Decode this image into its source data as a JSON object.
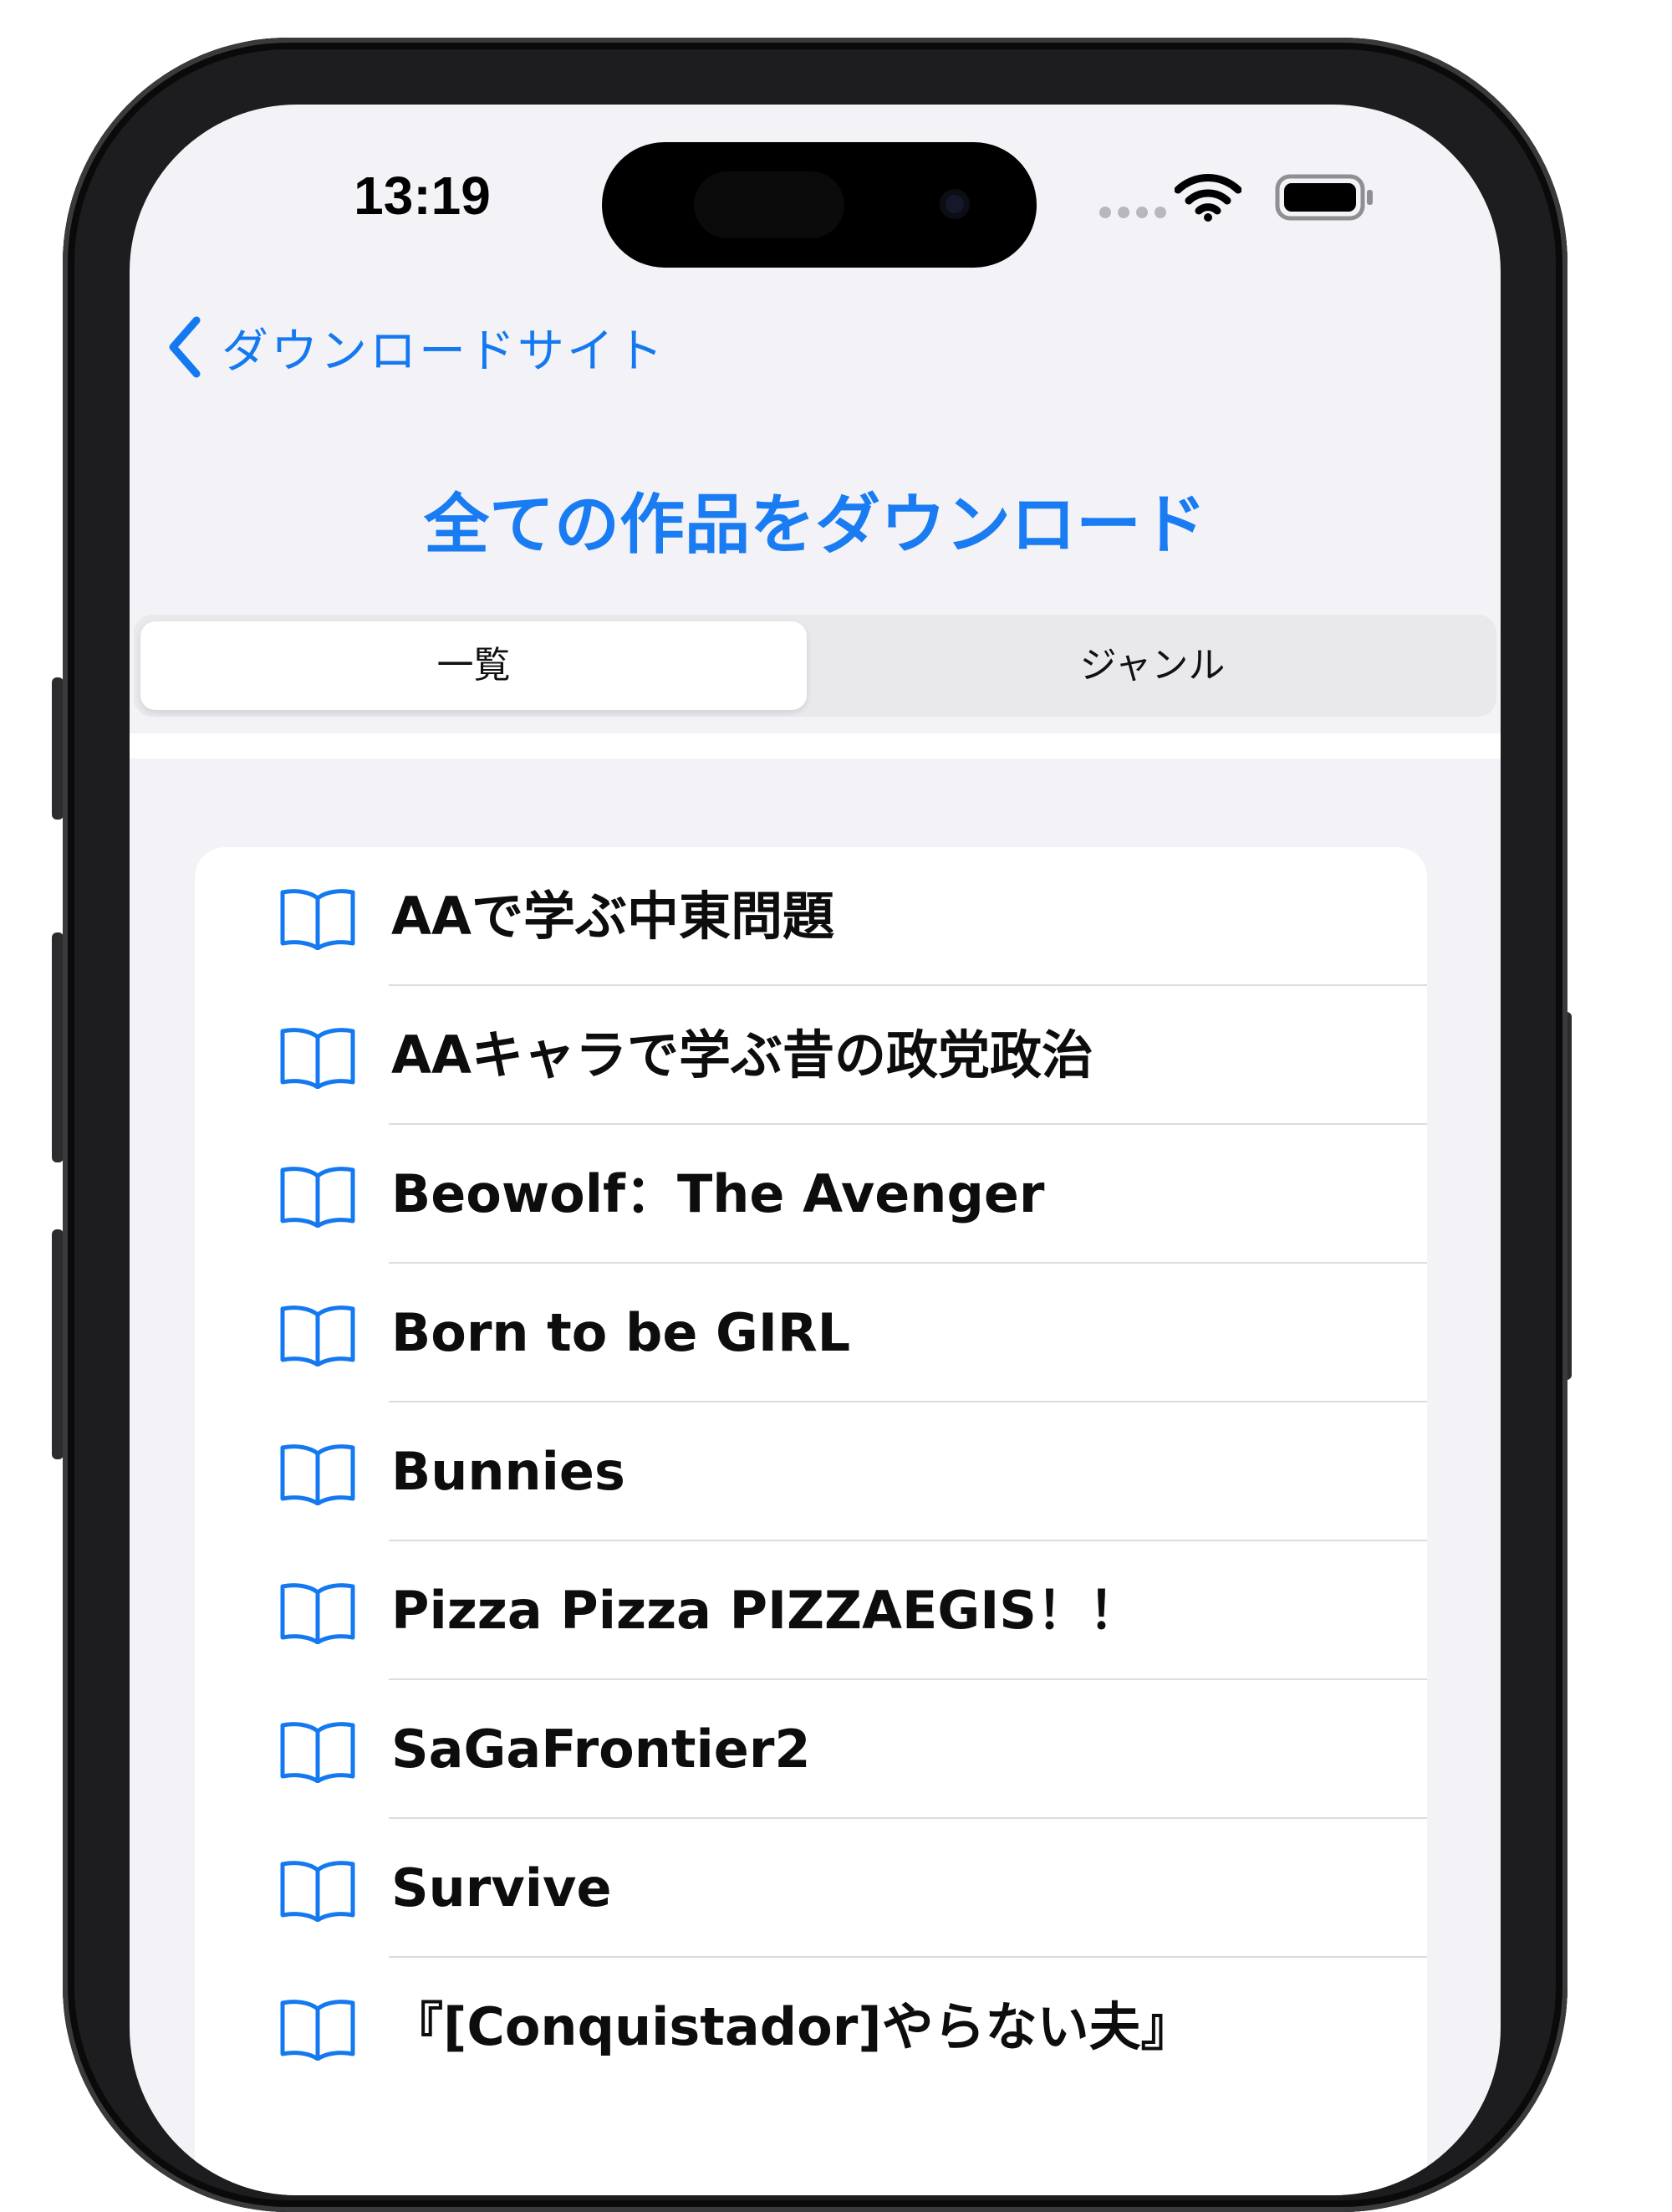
{
  "status_bar": {
    "time": "13:19"
  },
  "nav": {
    "back_label": "ダウンロードサイト",
    "title": "全ての作品をダウンロード"
  },
  "segmented": {
    "segments": [
      "一覧",
      "ジャンル"
    ],
    "selected": "一覧"
  },
  "list": {
    "items": [
      {
        "title": "AAで学ぶ中東問題",
        "icon": "book-icon"
      },
      {
        "title": "AAキャラで学ぶ昔の政党政治",
        "icon": "book-icon"
      },
      {
        "title": "Beowolf：The Avenger",
        "icon": "book-icon"
      },
      {
        "title": "Born to be GIRL",
        "icon": "book-icon"
      },
      {
        "title": "Bunnies",
        "icon": "book-icon"
      },
      {
        "title": "Pizza Pizza PIZZAEGIS！！",
        "icon": "book-icon"
      },
      {
        "title": "SaGaFrontier2",
        "icon": "book-icon"
      },
      {
        "title": "Survive",
        "icon": "book-icon"
      },
      {
        "title": "『[Conquistador]やらない夫』",
        "icon": "book-icon"
      }
    ]
  },
  "colors": {
    "accent": "#1479f0",
    "background": "#f2f2f7",
    "separator": "#dcdce0"
  }
}
